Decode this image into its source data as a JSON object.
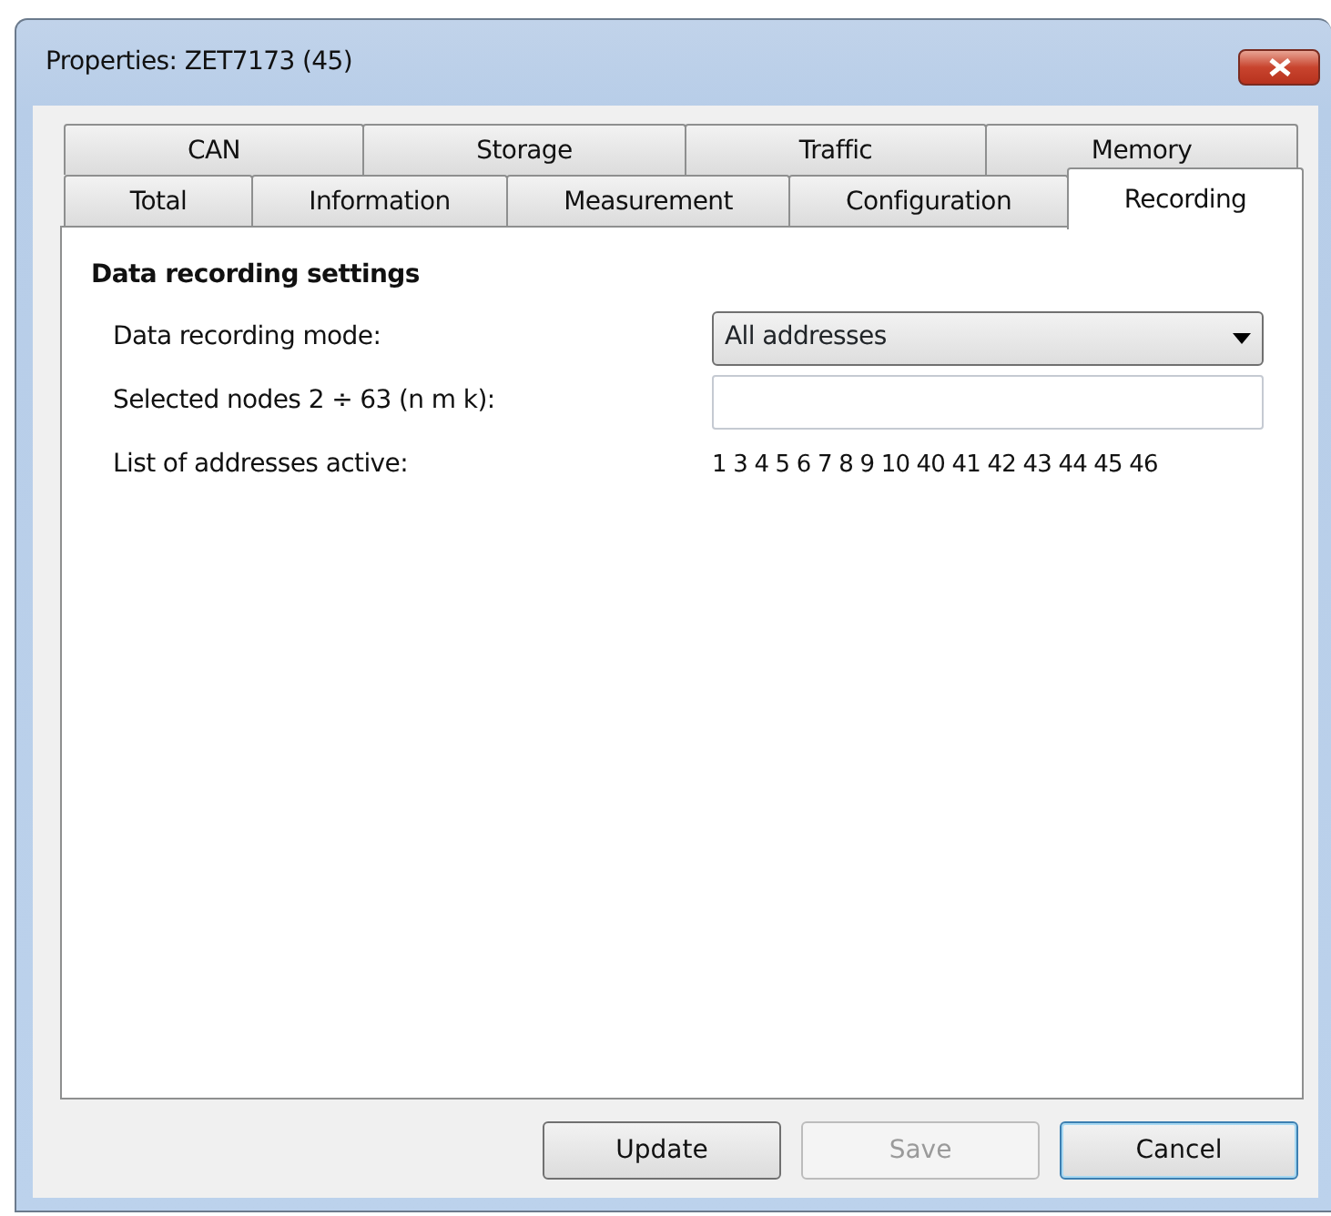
{
  "window": {
    "title": "Properties: ZET7173 (45)"
  },
  "tab_rows": [
    [
      {
        "label": "CAN",
        "selected": false
      },
      {
        "label": "Storage",
        "selected": false
      },
      {
        "label": "Traffic",
        "selected": false
      },
      {
        "label": "Memory",
        "selected": false
      }
    ],
    [
      {
        "label": "Total",
        "selected": false
      },
      {
        "label": "Information",
        "selected": false
      },
      {
        "label": "Measurement",
        "selected": false
      },
      {
        "label": "Configuration",
        "selected": false
      },
      {
        "label": "Recording",
        "selected": true
      }
    ]
  ],
  "section_title": "Data recording settings",
  "fields": [
    {
      "kind": "dropdown",
      "label": "Data recording mode:",
      "value": "All addresses"
    },
    {
      "kind": "input",
      "label": "Selected nodes 2 ÷ 63 (n m k):"
    },
    {
      "kind": "text",
      "label": "List of addresses active:",
      "value": "1 3 4 5 6 7 8 9 10 40 41 42 43 44 45 46"
    }
  ],
  "buttons": [
    {
      "label": "Update",
      "disabled": false,
      "default": false
    },
    {
      "label": "Save",
      "disabled": true,
      "default": false
    },
    {
      "label": "Cancel",
      "disabled": false,
      "default": true
    }
  ]
}
